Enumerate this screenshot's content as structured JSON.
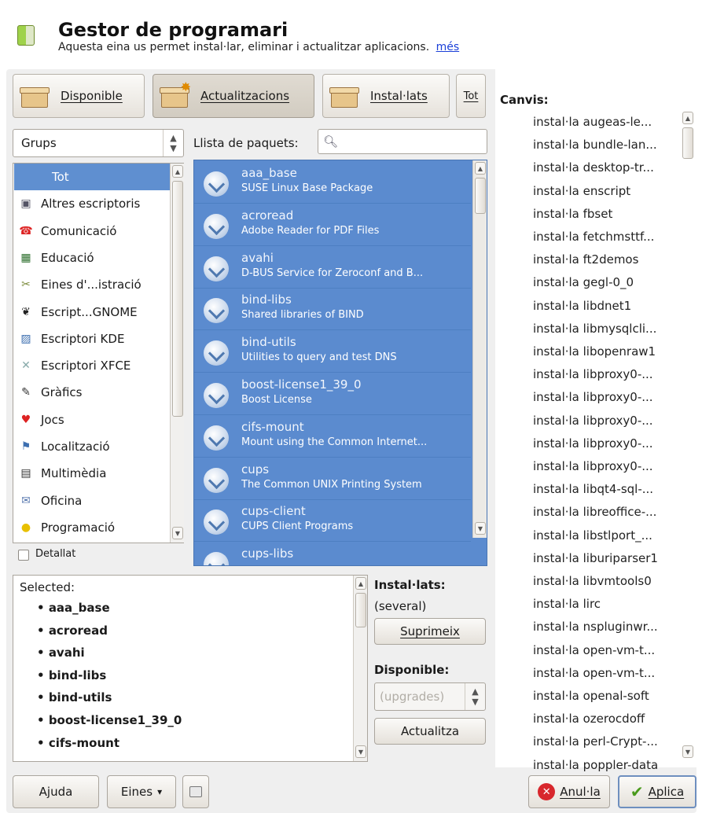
{
  "header": {
    "title": "Gestor de programari",
    "description": "Aquesta eina us permet instal·lar, eliminar i actualitzar aplicacions.",
    "more_link": "més"
  },
  "toolbar": {
    "available": "Disponible",
    "updates": "Actualitzacions",
    "installed": "Instal·lats",
    "all": "Tot"
  },
  "filter": {
    "groups_combo": "Grups",
    "package_list_label": "Llista de paquets:"
  },
  "groups": [
    {
      "label": "Tot",
      "icon": "all-icon"
    },
    {
      "label": "Altres escriptoris",
      "icon": "desktop-icon"
    },
    {
      "label": "Comunicació",
      "icon": "phone-icon"
    },
    {
      "label": "Educació",
      "icon": "blackboard-icon"
    },
    {
      "label": "Eines d'...istració",
      "icon": "tools-icon"
    },
    {
      "label": "Escript...GNOME",
      "icon": "gnome-foot-icon"
    },
    {
      "label": "Escriptori KDE",
      "icon": "kde-icon"
    },
    {
      "label": "Escriptori XFCE",
      "icon": "xfce-icon"
    },
    {
      "label": "Gràfics",
      "icon": "brush-icon"
    },
    {
      "label": "Jocs",
      "icon": "cards-icon"
    },
    {
      "label": "Localització",
      "icon": "flag-icon"
    },
    {
      "label": "Multimèdia",
      "icon": "clapperboard-icon"
    },
    {
      "label": "Oficina",
      "icon": "office-icon"
    },
    {
      "label": "Programació",
      "icon": "bulb-icon"
    }
  ],
  "detailed_label": "Detallat",
  "packages": [
    {
      "name": "aaa_base",
      "desc": "SUSE Linux Base Package"
    },
    {
      "name": "acroread",
      "desc": "Adobe Reader for PDF Files"
    },
    {
      "name": "avahi",
      "desc": "D-BUS Service for Zeroconf and B..."
    },
    {
      "name": "bind-libs",
      "desc": "Shared libraries of BIND"
    },
    {
      "name": "bind-utils",
      "desc": "Utilities to query and test DNS"
    },
    {
      "name": "boost-license1_39_0",
      "desc": "Boost License"
    },
    {
      "name": "cifs-mount",
      "desc": "Mount using the Common Internet..."
    },
    {
      "name": "cups",
      "desc": "The Common UNIX Printing System"
    },
    {
      "name": "cups-client",
      "desc": "CUPS Client Programs"
    },
    {
      "name": "cups-libs",
      "desc": ""
    }
  ],
  "details": {
    "title": "Selected:",
    "items": [
      "aaa_base",
      "acroread",
      "avahi",
      "bind-libs",
      "bind-utils",
      "boost-license1_39_0",
      "cifs-mount"
    ]
  },
  "actions": {
    "installed_label": "Instal·lats:",
    "installed_value": "(several)",
    "remove": "Suprimeix",
    "available_label": "Disponible:",
    "available_combo": "(upgrades)",
    "update": "Actualitza"
  },
  "changes": {
    "title": "Canvis:",
    "items": [
      "instal·la augeas-le...",
      "instal·la bundle-lan...",
      "instal·la desktop-tr...",
      "instal·la enscript",
      "instal·la fbset",
      "instal·la fetchmsttf...",
      "instal·la ft2demos",
      "instal·la gegl-0_0",
      "instal·la libdnet1",
      "instal·la libmysqlcli...",
      "instal·la libopenraw1",
      "instal·la libproxy0-...",
      "instal·la libproxy0-...",
      "instal·la libproxy0-...",
      "instal·la libproxy0-...",
      "instal·la libproxy0-...",
      "instal·la libqt4-sql-...",
      "instal·la libreoffice-...",
      "instal·la libstlport_...",
      "instal·la liburiparser1",
      "instal·la libvmtools0",
      "instal·la lirc",
      "instal·la nspluginwr...",
      "instal·la open-vm-t...",
      "instal·la open-vm-t...",
      "instal·la openal-soft",
      "instal·la ozerocdoff",
      "instal·la perl-Crypt-...",
      "instal·la poppler-data"
    ]
  },
  "footer": {
    "help": "Ajuda",
    "tools": "Eines",
    "cancel": "Anul·la",
    "apply": "Aplica"
  }
}
